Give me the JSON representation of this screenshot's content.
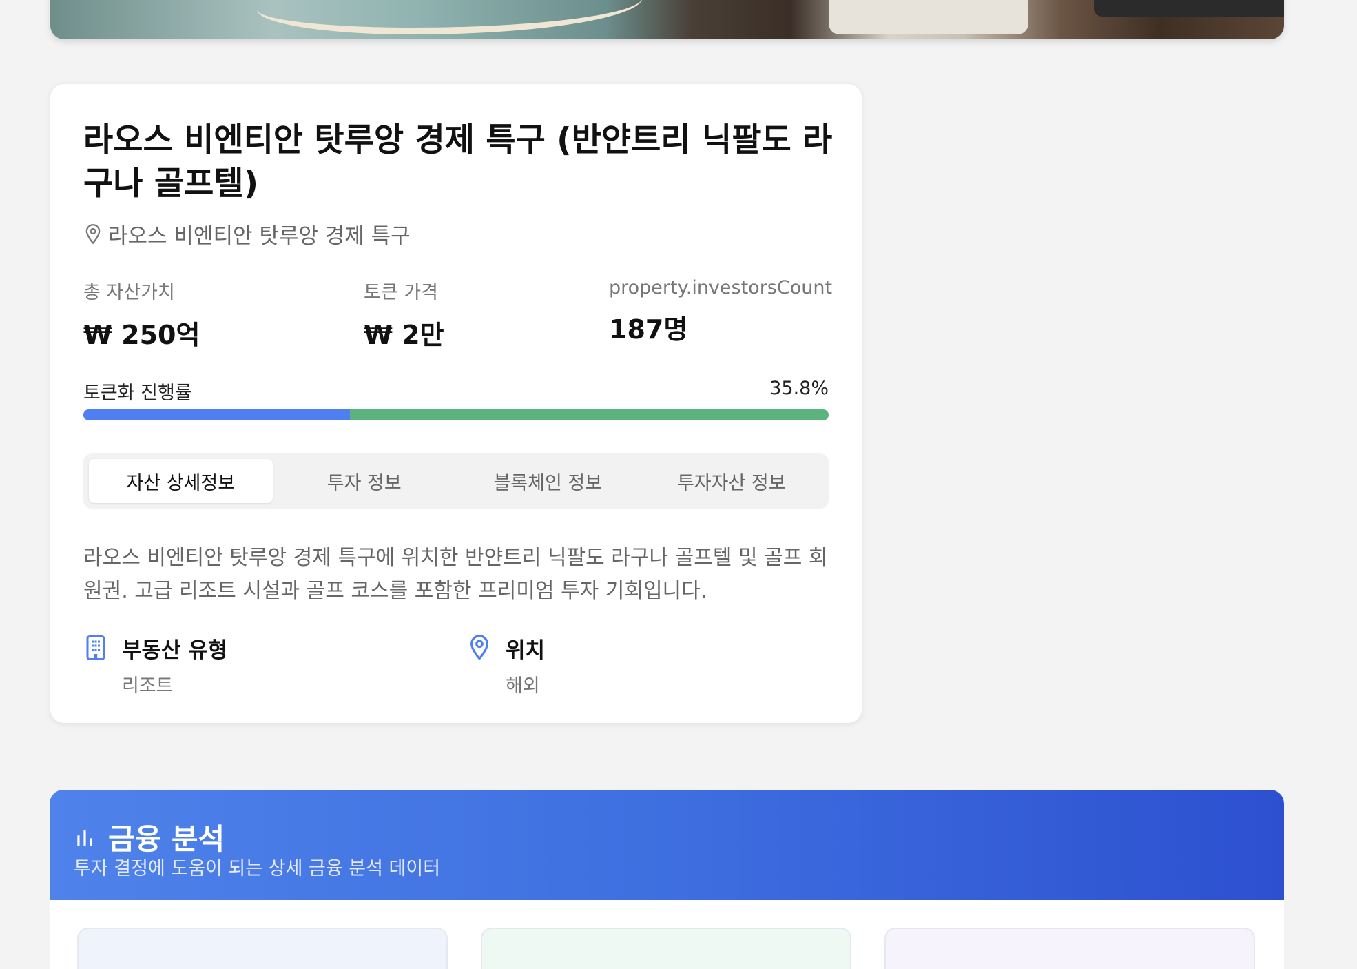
{
  "property": {
    "title": "라오스 비엔티안 탓루앙 경제 특구 (반얀트리 닉팔도 라구나 골프텔)",
    "location": "라오스 비엔티안 탓루앙 경제 특구",
    "stats": [
      {
        "label": "총 자산가치",
        "value": "₩ 250억"
      },
      {
        "label": "토큰 가격",
        "value": "₩ 2만"
      },
      {
        "label": "property.investorsCount",
        "value": "187명"
      }
    ],
    "progress": {
      "label": "토큰화 진행률",
      "percent_text": "35.8%",
      "value": 35.8
    },
    "tabs": [
      "자산 상세정보",
      "투자 정보",
      "블록체인 정보",
      "투자자산 정보"
    ],
    "active_tab": 0,
    "description": "라오스 비엔티안 탓루앙 경제 특구에 위치한 반얀트리 닉팔도 라구나 골프텔 및 골프 회원권. 고급 리조트 시설과 골프 코스를 포함한 프리미엄 투자 기회입니다.",
    "info": [
      {
        "icon": "building-icon",
        "key": "부동산 유형",
        "value": "리조트"
      },
      {
        "icon": "map-pin-icon",
        "key": "위치",
        "value": "해외"
      }
    ]
  },
  "finance": {
    "title": "금융 분석",
    "subtitle": "투자 결정에 도움이 되는 상세 금융 분석 데이터",
    "icon": "bar-chart-icon"
  },
  "colors": {
    "accent": "#4f7ff0",
    "progress_remaining": "#5bb37f",
    "finance_gradient_start": "#4f82ea",
    "finance_gradient_end": "#2d50d0"
  }
}
